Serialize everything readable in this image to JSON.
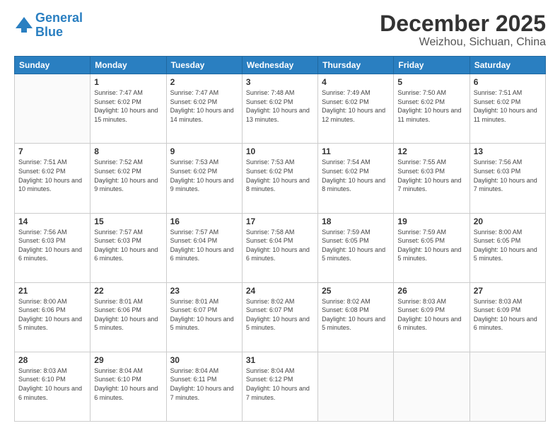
{
  "header": {
    "logo_line1": "General",
    "logo_line2": "Blue",
    "title": "December 2025",
    "subtitle": "Weizhou, Sichuan, China"
  },
  "calendar": {
    "days_of_week": [
      "Sunday",
      "Monday",
      "Tuesday",
      "Wednesday",
      "Thursday",
      "Friday",
      "Saturday"
    ],
    "weeks": [
      [
        {
          "day": "",
          "sunrise": "",
          "sunset": "",
          "daylight": ""
        },
        {
          "day": "1",
          "sunrise": "7:47 AM",
          "sunset": "6:02 PM",
          "daylight": "10 hours and 15 minutes."
        },
        {
          "day": "2",
          "sunrise": "7:47 AM",
          "sunset": "6:02 PM",
          "daylight": "10 hours and 14 minutes."
        },
        {
          "day": "3",
          "sunrise": "7:48 AM",
          "sunset": "6:02 PM",
          "daylight": "10 hours and 13 minutes."
        },
        {
          "day": "4",
          "sunrise": "7:49 AM",
          "sunset": "6:02 PM",
          "daylight": "10 hours and 12 minutes."
        },
        {
          "day": "5",
          "sunrise": "7:50 AM",
          "sunset": "6:02 PM",
          "daylight": "10 hours and 11 minutes."
        },
        {
          "day": "6",
          "sunrise": "7:51 AM",
          "sunset": "6:02 PM",
          "daylight": "10 hours and 11 minutes."
        }
      ],
      [
        {
          "day": "7",
          "sunrise": "7:51 AM",
          "sunset": "6:02 PM",
          "daylight": "10 hours and 10 minutes."
        },
        {
          "day": "8",
          "sunrise": "7:52 AM",
          "sunset": "6:02 PM",
          "daylight": "10 hours and 9 minutes."
        },
        {
          "day": "9",
          "sunrise": "7:53 AM",
          "sunset": "6:02 PM",
          "daylight": "10 hours and 9 minutes."
        },
        {
          "day": "10",
          "sunrise": "7:53 AM",
          "sunset": "6:02 PM",
          "daylight": "10 hours and 8 minutes."
        },
        {
          "day": "11",
          "sunrise": "7:54 AM",
          "sunset": "6:02 PM",
          "daylight": "10 hours and 8 minutes."
        },
        {
          "day": "12",
          "sunrise": "7:55 AM",
          "sunset": "6:03 PM",
          "daylight": "10 hours and 7 minutes."
        },
        {
          "day": "13",
          "sunrise": "7:56 AM",
          "sunset": "6:03 PM",
          "daylight": "10 hours and 7 minutes."
        }
      ],
      [
        {
          "day": "14",
          "sunrise": "7:56 AM",
          "sunset": "6:03 PM",
          "daylight": "10 hours and 6 minutes."
        },
        {
          "day": "15",
          "sunrise": "7:57 AM",
          "sunset": "6:03 PM",
          "daylight": "10 hours and 6 minutes."
        },
        {
          "day": "16",
          "sunrise": "7:57 AM",
          "sunset": "6:04 PM",
          "daylight": "10 hours and 6 minutes."
        },
        {
          "day": "17",
          "sunrise": "7:58 AM",
          "sunset": "6:04 PM",
          "daylight": "10 hours and 6 minutes."
        },
        {
          "day": "18",
          "sunrise": "7:59 AM",
          "sunset": "6:05 PM",
          "daylight": "10 hours and 5 minutes."
        },
        {
          "day": "19",
          "sunrise": "7:59 AM",
          "sunset": "6:05 PM",
          "daylight": "10 hours and 5 minutes."
        },
        {
          "day": "20",
          "sunrise": "8:00 AM",
          "sunset": "6:05 PM",
          "daylight": "10 hours and 5 minutes."
        }
      ],
      [
        {
          "day": "21",
          "sunrise": "8:00 AM",
          "sunset": "6:06 PM",
          "daylight": "10 hours and 5 minutes."
        },
        {
          "day": "22",
          "sunrise": "8:01 AM",
          "sunset": "6:06 PM",
          "daylight": "10 hours and 5 minutes."
        },
        {
          "day": "23",
          "sunrise": "8:01 AM",
          "sunset": "6:07 PM",
          "daylight": "10 hours and 5 minutes."
        },
        {
          "day": "24",
          "sunrise": "8:02 AM",
          "sunset": "6:07 PM",
          "daylight": "10 hours and 5 minutes."
        },
        {
          "day": "25",
          "sunrise": "8:02 AM",
          "sunset": "6:08 PM",
          "daylight": "10 hours and 5 minutes."
        },
        {
          "day": "26",
          "sunrise": "8:03 AM",
          "sunset": "6:09 PM",
          "daylight": "10 hours and 6 minutes."
        },
        {
          "day": "27",
          "sunrise": "8:03 AM",
          "sunset": "6:09 PM",
          "daylight": "10 hours and 6 minutes."
        }
      ],
      [
        {
          "day": "28",
          "sunrise": "8:03 AM",
          "sunset": "6:10 PM",
          "daylight": "10 hours and 6 minutes."
        },
        {
          "day": "29",
          "sunrise": "8:04 AM",
          "sunset": "6:10 PM",
          "daylight": "10 hours and 6 minutes."
        },
        {
          "day": "30",
          "sunrise": "8:04 AM",
          "sunset": "6:11 PM",
          "daylight": "10 hours and 7 minutes."
        },
        {
          "day": "31",
          "sunrise": "8:04 AM",
          "sunset": "6:12 PM",
          "daylight": "10 hours and 7 minutes."
        },
        {
          "day": "",
          "sunrise": "",
          "sunset": "",
          "daylight": ""
        },
        {
          "day": "",
          "sunrise": "",
          "sunset": "",
          "daylight": ""
        },
        {
          "day": "",
          "sunrise": "",
          "sunset": "",
          "daylight": ""
        }
      ]
    ],
    "labels": {
      "sunrise": "Sunrise:",
      "sunset": "Sunset:",
      "daylight": "Daylight:"
    }
  }
}
